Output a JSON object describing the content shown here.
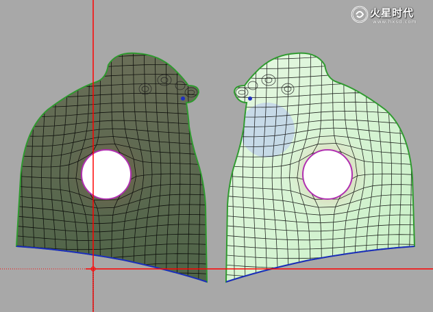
{
  "viewport": {
    "name": "uv-editor-viewport",
    "background": "#a8a8a8",
    "crosshair_color": "#ff0000"
  },
  "watermark": {
    "logo_icon": "swirl-logo-icon",
    "text": "火星时代",
    "url": "www.hxsd.com"
  },
  "uv_shells": [
    {
      "name": "uv-shell-left",
      "fill": "#5f6a52",
      "wire": "#000000",
      "border": "#2f9a2f",
      "seam": "#1d2bbf"
    },
    {
      "name": "uv-shell-right",
      "fill": "#d8f6d2",
      "wire": "#000000",
      "border": "#2f9a2f",
      "seam": "#1d2bbf"
    }
  ]
}
